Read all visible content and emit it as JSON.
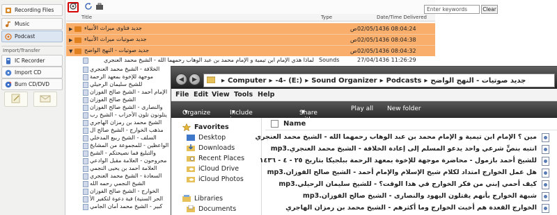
{
  "sidebar": {
    "items": [
      {
        "label": "Recording Files",
        "icon": "recording-files-icon"
      },
      {
        "label": "Music",
        "icon": "music-icon"
      },
      {
        "label": "Podcast",
        "icon": "podcast-icon"
      }
    ],
    "section_caption": "Import/Transfer",
    "transfer_items": [
      {
        "label": "IC Recorder",
        "icon": "ic-recorder-icon"
      },
      {
        "label": "Import CD",
        "icon": "cd-icon"
      },
      {
        "label": "Burn CD/DVD",
        "icon": "burn-disc-icon"
      }
    ]
  },
  "search": {
    "placeholder": "Enter keywords",
    "clear_label": "Clear"
  },
  "columns": {
    "title": "Title",
    "type": "Type",
    "date": "Date/Time Delivered"
  },
  "folders": [
    {
      "title": "جديد فتاوى ميراث الأنبياء",
      "ampm": "ص",
      "date": "02/05/1436 08:04:24"
    },
    {
      "title": "جديد صوتيات ميراث الأنبياء",
      "ampm": "ص",
      "date": "02/05/1436 08:04:38"
    },
    {
      "title": "جديد صوتيات - النهج الواضح",
      "ampm": "ص",
      "date": "02/05/1436 08:04:32"
    }
  ],
  "episode_row": {
    "title": "لماذا هذي الإمام ابن تيمية و الإمام محمد بن عبد الوهاب رحمهما الله - الشيخ محمد العنجري",
    "type": "Sounds",
    "date": "27/04/1436 11:26:29"
  },
  "sub_items": [
    "الخلافة - الشيخ محمد العنجري",
    "موجهة للإخوة بمعهد الرحمة",
    "للشيخ سليمان الرحيلي",
    "الإمام أحمد - الشيخ صالح الفوزان",
    "الشيخ صالح الفوزان",
    "والنصارى - الشيخ صالح الفوزان",
    "يتلونون تلون الأحزاب - الشيخ رب",
    "الشيخ محمد بن رمزان الهاجري",
    "مذهب الخوارج - الشيخ صالح ال",
    "السلف - الشيخ ربيع المدخلي",
    "الواعظين - للمجموعة من المشايخ",
    "والتبليغ فما نصيحتكم - الشيخ",
    "محروحون - العلامة مقبل الوادعي",
    "العلامة أحمد بن يحيى النجمي",
    "السعادة - الشيخ محمد العنجري",
    "الشيخ النجمي رحمه الله",
    "الخوارج - الشيخ صالح الفوزان",
    "الحر السنية) فية دعوة لتكفير الأ",
    "كبير - الشيخ محمد أمان الجامي",
    "التكفير - الشيخ سليمان الرحيلي"
  ],
  "explorer": {
    "path": [
      "Computer",
      "-4- (E:)",
      "Sound Organizer",
      "Podcasts",
      "جديد صوتيات - النهج الواضح"
    ],
    "menu": [
      "File",
      "Edit",
      "View",
      "Tools",
      "Help"
    ],
    "commands": [
      "Organize",
      "Include in library",
      "Share with",
      "Play all",
      "New folder"
    ],
    "nav": {
      "favorites": "Favorites",
      "items": [
        "Desktop",
        "Downloads",
        "Recent Places",
        "iCloud Drive",
        "iCloud Photos"
      ],
      "libraries": "Libraries",
      "lib_items": [
        "Documents"
      ]
    },
    "name_header": "Name",
    "files": [
      "مين ؟ الإمام ابن تيمية و الإمام محمد بن عبد الوهاب رحمهما الله - الشيخ محمد العنجري",
      "mp3.انتبه بنصٍّ شرعي واحد يدعو المسلم إلى إعادة الخلافة - الشيخ محمد العنجري",
      "للشيخ أحمد بازمول - محاضرة موجهة للإخوة بمعهد الرحمة ببلجيكا بتاريخ ٢٥ - ٤ - ١٤٣٦",
      "mp3.هل عمل الخوارج امتداد لكلام شيخ الإسلام والإمام أحمد - الشيخ صالح الفوزان",
      "mp3.كيف أحمي إبني من فكر الخوارج في هذا الوقت؟ - للشيخ سليمان الرحيلي",
      "mp3.شبهة الخوارج بأنهم يقتلون اليهود والنصارى - الشيخ صالح الفوزان",
      "الخوارج القعدة هم أخبث الخوارج وما أكثرهم - الشيخ محمد بن رمزان الهاجري"
    ]
  },
  "colors": {
    "folder_row": "#f9ae6b",
    "toolbar_highlight": "#d40000",
    "addr_bar": "#2b2b2b"
  }
}
